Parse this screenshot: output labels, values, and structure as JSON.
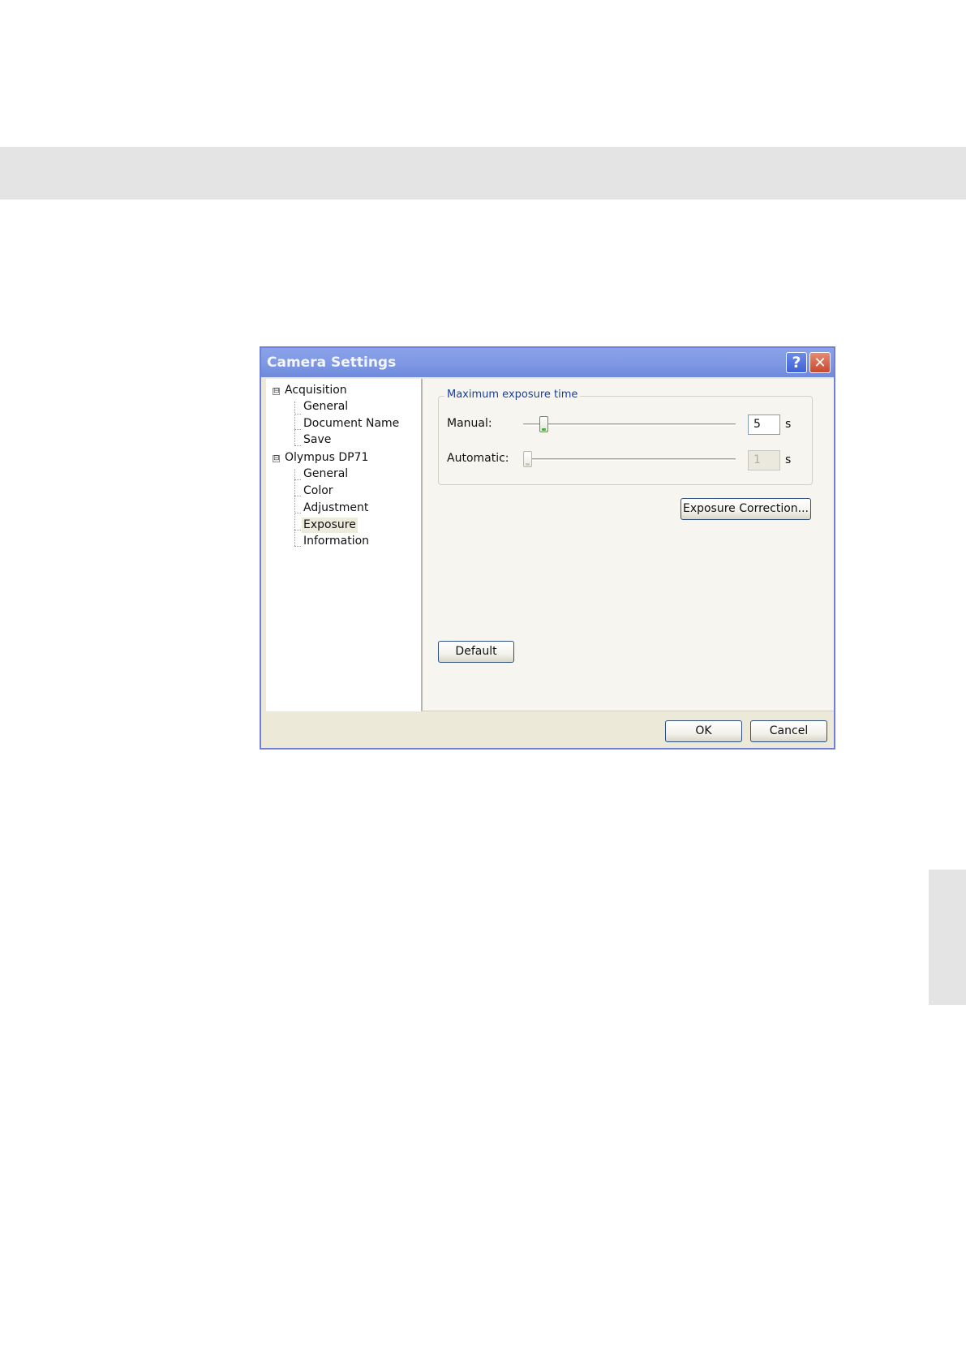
{
  "dialog": {
    "title": "Camera Settings",
    "help_label": "?",
    "close_label": "✕"
  },
  "tree": {
    "groups": [
      {
        "label": "Acquisition",
        "toggle": "⊟",
        "children": [
          "General",
          "Document Name",
          "Save"
        ]
      },
      {
        "label": "Olympus DP71",
        "toggle": "⊟",
        "children": [
          "General",
          "Color",
          "Adjustment",
          "Exposure",
          "Information"
        ]
      }
    ],
    "selected": "Exposure"
  },
  "exposure": {
    "group_title": "Maximum exposure time",
    "manual": {
      "label": "Manual:",
      "value": "5",
      "unit": "s",
      "slider_fraction": 0.08,
      "enabled": true
    },
    "automatic": {
      "label": "Automatic:",
      "value": "1",
      "unit": "s",
      "slider_fraction": 0.0,
      "enabled": false
    },
    "correction_button": "Exposure Correction...",
    "default_button": "Default"
  },
  "footer": {
    "ok_label": "OK",
    "cancel_label": "Cancel"
  }
}
